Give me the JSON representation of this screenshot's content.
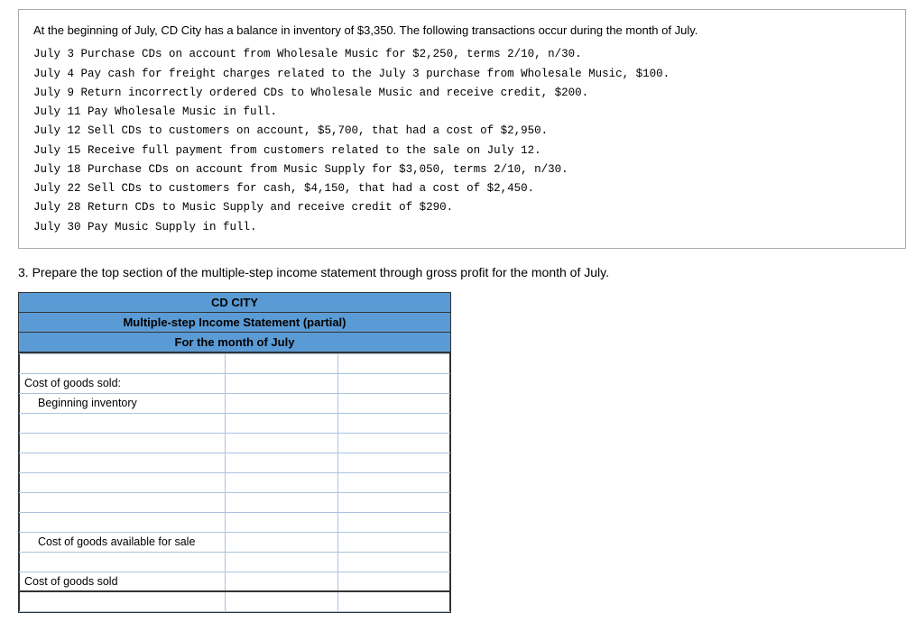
{
  "problem": {
    "intro": "At the beginning of July, CD City has a balance in inventory of $3,350. The following transactions occur during the month of July.",
    "transactions": [
      "July  3 Purchase CDs on account from Wholesale Music for $2,250, terms 2/10, n/30.",
      "July  4 Pay cash for freight charges related to the July 3 purchase from Wholesale Music, $100.",
      "July  9 Return incorrectly ordered CDs to Wholesale Music and receive credit, $200.",
      "July 11 Pay Wholesale Music in full.",
      "July 12 Sell CDs to customers on account, $5,700, that had a cost of $2,950.",
      "July 15 Receive full payment from customers related to the sale on July 12.",
      "July 18 Purchase CDs on account from Music Supply for $3,050, terms 2/10, n/30.",
      "July 22 Sell CDs to customers for cash, $4,150, that had a cost of $2,450.",
      "July 28 Return CDs to Music Supply and receive credit of $290.",
      "July 30 Pay Music Supply in full."
    ]
  },
  "question": {
    "number": "3.",
    "text": "Prepare the top section of the multiple-step income statement through gross profit for the month of July."
  },
  "statement": {
    "title": "CD CITY",
    "subtitle": "Multiple-step Income Statement (partial)",
    "period": "For the month of July",
    "rows": [
      {
        "label": "",
        "col1": "",
        "col2": "",
        "type": "empty"
      },
      {
        "label": "Cost of goods sold:",
        "col1": "",
        "col2": "",
        "type": "header"
      },
      {
        "label": "Beginning inventory",
        "col1": "",
        "col2": "",
        "type": "indented"
      },
      {
        "label": "",
        "col1": "",
        "col2": "",
        "type": "empty"
      },
      {
        "label": "",
        "col1": "",
        "col2": "",
        "type": "empty"
      },
      {
        "label": "",
        "col1": "",
        "col2": "",
        "type": "empty"
      },
      {
        "label": "",
        "col1": "",
        "col2": "",
        "type": "empty"
      },
      {
        "label": "",
        "col1": "",
        "col2": "",
        "type": "empty"
      },
      {
        "label": "",
        "col1": "",
        "col2": "",
        "type": "empty"
      },
      {
        "label": "    Cost of goods available for sale",
        "col1": "",
        "col2": "",
        "type": "subtotal"
      },
      {
        "label": "",
        "col1": "",
        "col2": "",
        "type": "empty"
      },
      {
        "label": "Cost of goods sold",
        "col1": "",
        "col2": "",
        "type": "total"
      }
    ]
  }
}
